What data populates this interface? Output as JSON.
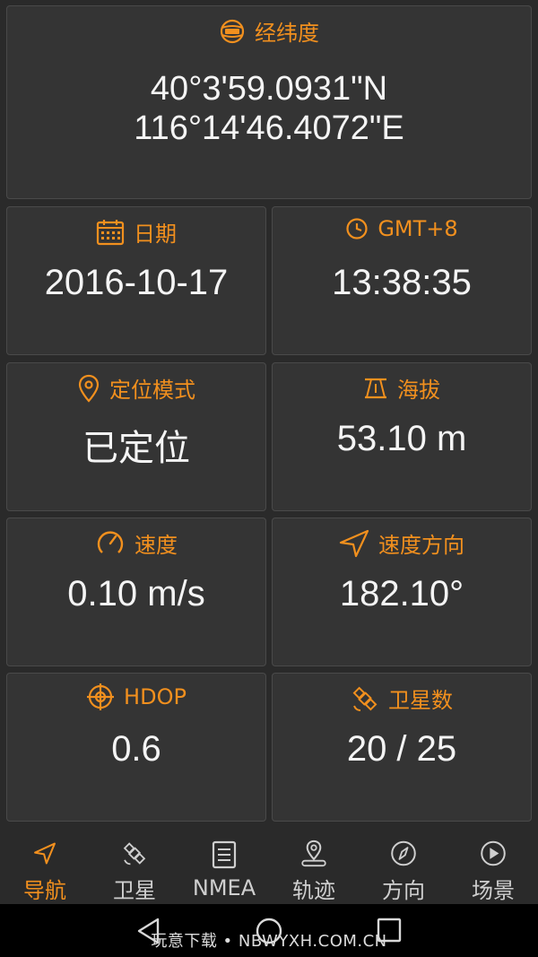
{
  "cards": {
    "coords": {
      "title": "经纬度",
      "lat": "40°3'59.0931\"N",
      "lon": "116°14'46.4072\"E"
    },
    "date": {
      "title": "日期",
      "value": "2016-10-17"
    },
    "time": {
      "title": "GMT+8",
      "value": "13:38:35"
    },
    "mode": {
      "title": "定位模式",
      "value": "已定位"
    },
    "altitude": {
      "title": "海拔",
      "value": "53.10 m"
    },
    "speed": {
      "title": "速度",
      "value": "0.10 m/s"
    },
    "heading": {
      "title": "速度方向",
      "value": "182.10°"
    },
    "hdop": {
      "title": "HDOP",
      "value": "0.6"
    },
    "satellites": {
      "title": "卫星数",
      "value": "20 / 25"
    }
  },
  "nav": {
    "items": [
      {
        "label": "导航",
        "icon": "navigation-arrow-icon",
        "active": true
      },
      {
        "label": "卫星",
        "icon": "satellite-icon"
      },
      {
        "label": "NMEA",
        "icon": "list-document-icon"
      },
      {
        "label": "轨迹",
        "icon": "location-pin-icon"
      },
      {
        "label": "方向",
        "icon": "compass-icon"
      },
      {
        "label": "场景",
        "icon": "play-circle-icon"
      }
    ]
  },
  "watermark": "玩意下载 • NBWYXH.COM.CN",
  "colors": {
    "accent": "#f2901e",
    "background": "#2a2a2a",
    "card": "#343434"
  }
}
